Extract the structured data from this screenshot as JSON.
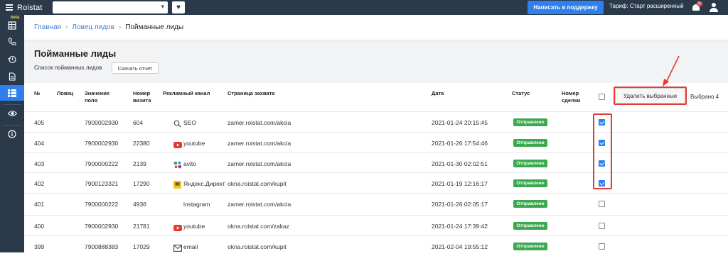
{
  "app": {
    "logo": "Roistat",
    "favorite_icon": "heart-icon"
  },
  "topbar": {
    "support_label": "Написать в поддержку",
    "tariff": "Тариф: Старт расширенный",
    "notification_badge": "9+"
  },
  "sidebar": {
    "beta_label": "beta",
    "items": [
      "table-icon",
      "phone-icon",
      "history-icon",
      "document-icon",
      "grid-icon",
      "eye-icon",
      "info-icon"
    ],
    "active": "grid-icon"
  },
  "breadcrumb": {
    "home": "Главная",
    "section": "Ловец лидов",
    "current": "Пойманные лиды"
  },
  "page": {
    "title": "Пойманные лиды",
    "subtitle": "Список пойманных лидов",
    "report_button": "Скачать отчет"
  },
  "table": {
    "headers": {
      "num": "№",
      "catcher": "Ловец",
      "field_value_1": "Значение",
      "field_value_2": "поля",
      "visit_1": "Номер",
      "visit_2": "визита",
      "channel": "Рекламный канал",
      "page": "Страница захвата",
      "date": "Дата",
      "status": "Статус",
      "deal_1": "Номер",
      "deal_2": "сделки"
    },
    "delete_button": "Удалить выбранные",
    "selected_count": "Выбрано 4",
    "rows": [
      {
        "num": "405",
        "value": "7900002930",
        "visit": "604",
        "channel": "SEO",
        "channel_icon": "search-icon",
        "page": "zamer.roistat.com/akcia",
        "date": "2021-01-24 20:15:45",
        "status": "Отправлено",
        "checked": true
      },
      {
        "num": "404",
        "value": "7900002930",
        "visit": "22380",
        "channel": "youtube",
        "channel_icon": "youtube-icon",
        "page": "zamer.roistat.com/akcia",
        "date": "2021-01-26 17:54:46",
        "status": "Отправлено",
        "checked": true
      },
      {
        "num": "403",
        "value": "7900000222",
        "visit": "2139",
        "channel": "avito",
        "channel_icon": "avito-icon",
        "page": "zamer.roistat.com/akcia",
        "date": "2021-01-30 02:02:51",
        "status": "Отправлено",
        "checked": true
      },
      {
        "num": "402",
        "value": "7900123321",
        "visit": "17290",
        "channel": "Яндекс.Директ",
        "channel_icon": "yandex-direct-icon",
        "page": "okna.roistat.com/kupit",
        "date": "2021-01-19 12:16:17",
        "status": "Отправлено",
        "checked": true
      },
      {
        "num": "401",
        "value": "7900000222",
        "visit": "4936",
        "channel": "instagram",
        "channel_icon": "",
        "page": "zamer.roistat.com/akcia",
        "date": "2021-01-26 02:05:17",
        "status": "Отправлено",
        "checked": false
      },
      {
        "num": "400",
        "value": "7900002930",
        "visit": "21781",
        "channel": "youtube",
        "channel_icon": "youtube-icon",
        "page": "okna.roistat.com/zakaz",
        "date": "2021-01-24 17:39:42",
        "status": "Отправлено",
        "checked": false
      },
      {
        "num": "399",
        "value": "7900888383",
        "visit": "17029",
        "channel": "email",
        "channel_icon": "mail-icon",
        "page": "okna.roistat.com/kupit",
        "date": "2021-02-04 19:55:12",
        "status": "Отправлено",
        "checked": false
      }
    ]
  },
  "colors": {
    "topbar": "#2a3a4b",
    "accent": "#2f80ed",
    "status_green": "#3aa84e",
    "highlight_red": "#e53935"
  }
}
